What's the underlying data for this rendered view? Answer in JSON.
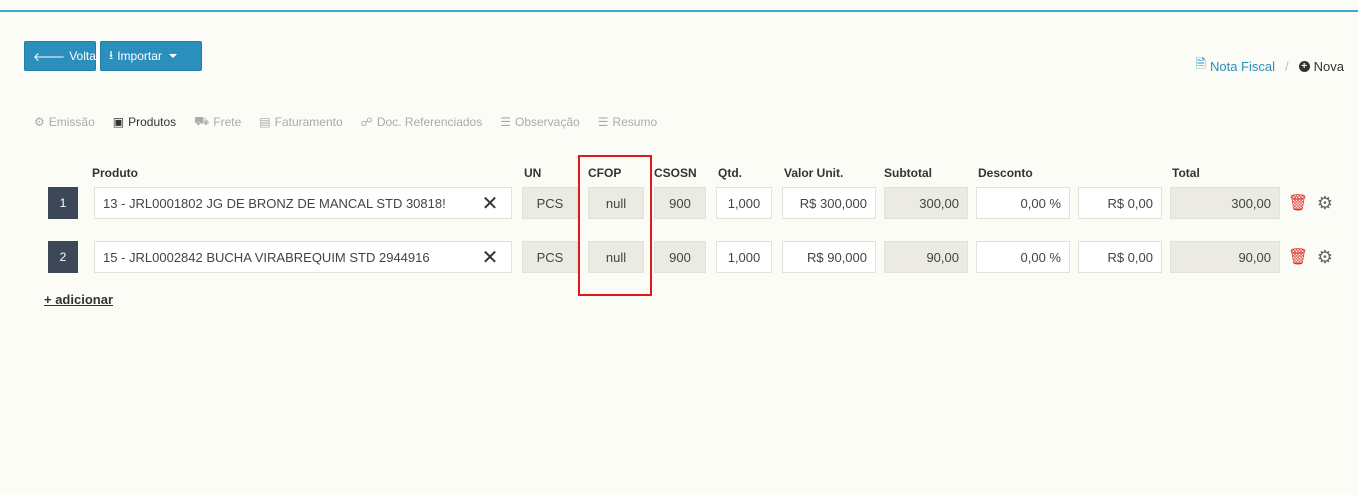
{
  "toolbar": {
    "voltar_label": "Voltar",
    "importar_label": "Importar"
  },
  "breadcrumb": {
    "nota_fiscal": "Nota Fiscal",
    "separator": "/",
    "current": "Nova"
  },
  "tabs": [
    {
      "label": "Emissão",
      "icon": "gear-icon",
      "active": false
    },
    {
      "label": "Produtos",
      "icon": "box-icon",
      "active": true
    },
    {
      "label": "Frete",
      "icon": "truck-icon",
      "active": false
    },
    {
      "label": "Faturamento",
      "icon": "barcode-icon",
      "active": false
    },
    {
      "label": "Doc. Referenciados",
      "icon": "link-icon",
      "active": false
    },
    {
      "label": "Observação",
      "icon": "list-icon",
      "active": false
    },
    {
      "label": "Resumo",
      "icon": "list-icon",
      "active": false
    }
  ],
  "headers": {
    "produto": "Produto",
    "un": "UN",
    "cfop": "CFOP",
    "csosn": "CSOSN",
    "qtd": "Qtd.",
    "valor_unit": "Valor Unit.",
    "subtotal": "Subtotal",
    "desconto": "Desconto",
    "total": "Total"
  },
  "rows": [
    {
      "num": "1",
      "produto": "13 - JRL0001802 JG DE BRONZ DE MANCAL STD 30818!",
      "un": "PCS",
      "cfop": "null",
      "csosn": "900",
      "qtd": "1,000",
      "valor_unit": "R$ 300,000",
      "subtotal": "300,00",
      "desconto_pct": "0,00 %",
      "desconto_val": "R$ 0,00",
      "total": "300,00"
    },
    {
      "num": "2",
      "produto": "15 - JRL0002842 BUCHA VIRABREQUIM STD 2944916",
      "un": "PCS",
      "cfop": "null",
      "csosn": "900",
      "qtd": "1,000",
      "valor_unit": "R$ 90,000",
      "subtotal": "90,00",
      "desconto_pct": "0,00 %",
      "desconto_val": "R$ 0,00",
      "total": "90,00"
    }
  ],
  "add_link": "+ adicionar",
  "colors": {
    "accent": "#2a8fbd",
    "highlight": "#e0191b",
    "delete": "#d9302b"
  }
}
